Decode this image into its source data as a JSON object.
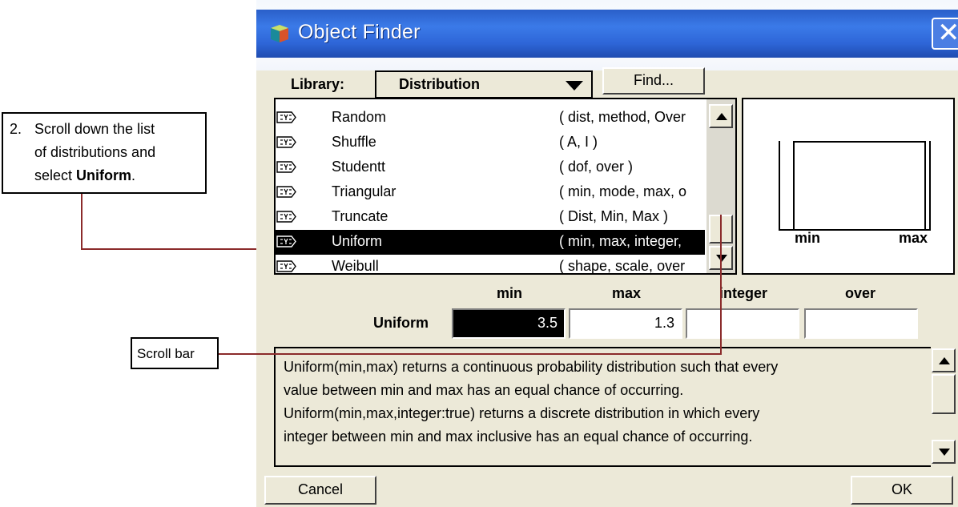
{
  "window": {
    "title": "Object Finder",
    "close_glyph": "✕",
    "icon": "app-cube-icon",
    "close_icon": "close-icon"
  },
  "library": {
    "label": "Library:",
    "selected": "Distribution",
    "find_label": "Find..."
  },
  "list": {
    "items": [
      {
        "name": "Random",
        "signature": "( dist, method, Over",
        "selected": false
      },
      {
        "name": "Shuffle",
        "signature": "( A, I )",
        "selected": false
      },
      {
        "name": "Studentt",
        "signature": "( dof, over )",
        "selected": false
      },
      {
        "name": "Triangular",
        "signature": "( min, mode, max, o",
        "selected": false
      },
      {
        "name": "Truncate",
        "signature": "( Dist, Min, Max )",
        "selected": false
      },
      {
        "name": "Uniform",
        "signature": "( min, max, integer,",
        "selected": true
      },
      {
        "name": "Weibull",
        "signature": "( shape, scale, over",
        "selected": false
      }
    ],
    "item_icon": "sys-function-icon"
  },
  "preview": {
    "min_label": "min",
    "max_label": "max"
  },
  "params": {
    "function_name": "Uniform",
    "headers": [
      "min",
      "max",
      "integer",
      "over"
    ],
    "values": [
      "3.5",
      "1.3",
      "",
      ""
    ]
  },
  "description": {
    "lines": [
      "Uniform(min,max) returns a continuous probability distribution such that every",
      "value between min and max has an equal chance of occurring.",
      "Uniform(min,max,integer:true) returns a discrete distribution in which every",
      "integer between min and max inclusive has an equal chance of occurring."
    ]
  },
  "buttons": {
    "cancel": "Cancel",
    "ok": "OK"
  },
  "annotations": {
    "step_number": "2.",
    "step_line1": "Scroll down the list",
    "step_line2": "of distributions and",
    "step_line3_prefix": "select ",
    "step_line3_bold": "Uniform",
    "step_line3_suffix": ".",
    "scroll_bar_label": "Scroll bar"
  },
  "colors": {
    "titlebar": "#2e66d8",
    "dialog_bg": "#ece9d8",
    "leader_line": "#8b2b2b",
    "selection": "#000000"
  }
}
